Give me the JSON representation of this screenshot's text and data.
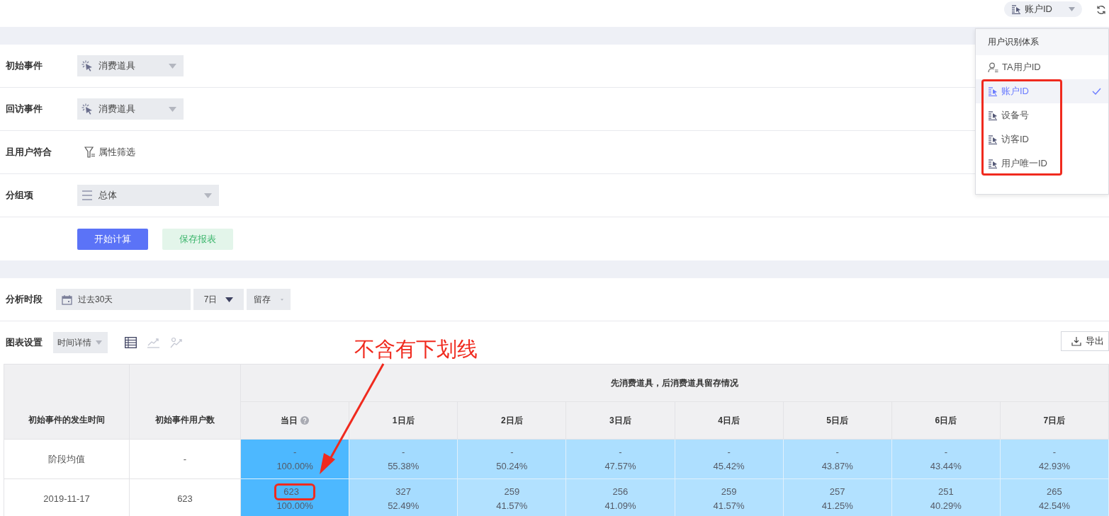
{
  "top_bar": {
    "id_selector": "账户ID"
  },
  "id_menu": {
    "header": "用户识别体系",
    "items": [
      {
        "label": "TA用户ID",
        "kind": "person",
        "selected": false,
        "highlighted": false
      },
      {
        "label": "账户ID",
        "kind": "id",
        "selected": true,
        "highlighted": true
      },
      {
        "label": "设备号",
        "kind": "id",
        "selected": false,
        "highlighted": true
      },
      {
        "label": "访客ID",
        "kind": "id",
        "selected": false,
        "highlighted": true
      },
      {
        "label": "用户唯一ID",
        "kind": "id",
        "selected": false,
        "highlighted": true
      }
    ]
  },
  "form": {
    "rows": [
      {
        "label": "初始事件",
        "kind": "event",
        "value": "消费道具"
      },
      {
        "label": "回访事件",
        "kind": "event",
        "value": "消费道具"
      },
      {
        "label": "且用户符合",
        "kind": "filter",
        "value": "属性筛选"
      },
      {
        "label": "分组项",
        "kind": "group",
        "value": "总体"
      }
    ],
    "buttons": [
      {
        "label": "开始计算",
        "kind": "primary"
      },
      {
        "label": "保存报表",
        "kind": "secondary"
      }
    ]
  },
  "analysis": {
    "period_label": "分析时段",
    "date_range": "过去30天",
    "interval": "7日",
    "metric": "留存",
    "chart_settings_label": "图表设置",
    "view_mode": "时间详情",
    "chart_views": [
      {
        "kind": "table",
        "selected": true
      },
      {
        "kind": "line",
        "selected": false
      },
      {
        "kind": "scatter",
        "selected": false
      }
    ],
    "export": "导出"
  },
  "annotation": {
    "text": "不含有下划线"
  },
  "table": {
    "group_header": "先消费道具，后消费道具留存情况",
    "row_header_columns": [
      "初始事件的发生时间",
      "初始事件用户数"
    ],
    "columns": [
      "当日",
      "1日后",
      "2日后",
      "3日后",
      "4日后",
      "5日后",
      "6日后",
      "7日后"
    ],
    "rows": [
      {
        "label": "阶段均值",
        "users": "-",
        "cells": [
          {
            "count": "-",
            "rate": "100.00%",
            "color": "#4db8ff",
            "highlighted": false
          },
          {
            "count": "-",
            "rate": "55.38%",
            "color": "#a3dbff",
            "highlighted": false
          },
          {
            "count": "-",
            "rate": "50.24%",
            "color": "#aadeff",
            "highlighted": false
          },
          {
            "count": "-",
            "rate": "47.57%",
            "color": "#acdfff",
            "highlighted": false
          },
          {
            "count": "-",
            "rate": "45.42%",
            "color": "#aedfff",
            "highlighted": false
          },
          {
            "count": "-",
            "rate": "43.87%",
            "color": "#b0e0ff",
            "highlighted": false
          },
          {
            "count": "-",
            "rate": "43.44%",
            "color": "#b0e0ff",
            "highlighted": false
          },
          {
            "count": "-",
            "rate": "42.93%",
            "color": "#b1e1ff",
            "highlighted": false
          }
        ]
      },
      {
        "label": "2019-11-17",
        "users": "623",
        "cells": [
          {
            "count": "623",
            "rate": "100.00%",
            "color": "#4db8ff",
            "highlighted": true
          },
          {
            "count": "327",
            "rate": "52.49%",
            "color": "#a6dcff",
            "highlighted": false
          },
          {
            "count": "259",
            "rate": "41.57%",
            "color": "#b2e1ff",
            "highlighted": false
          },
          {
            "count": "256",
            "rate": "41.09%",
            "color": "#b2e1ff",
            "highlighted": false
          },
          {
            "count": "259",
            "rate": "41.57%",
            "color": "#b2e1ff",
            "highlighted": false
          },
          {
            "count": "257",
            "rate": "41.25%",
            "color": "#b2e1ff",
            "highlighted": false
          },
          {
            "count": "251",
            "rate": "40.29%",
            "color": "#b4e2ff",
            "highlighted": false
          },
          {
            "count": "265",
            "rate": "42.54%",
            "color": "#b1e1ff",
            "highlighted": false
          }
        ]
      }
    ]
  }
}
